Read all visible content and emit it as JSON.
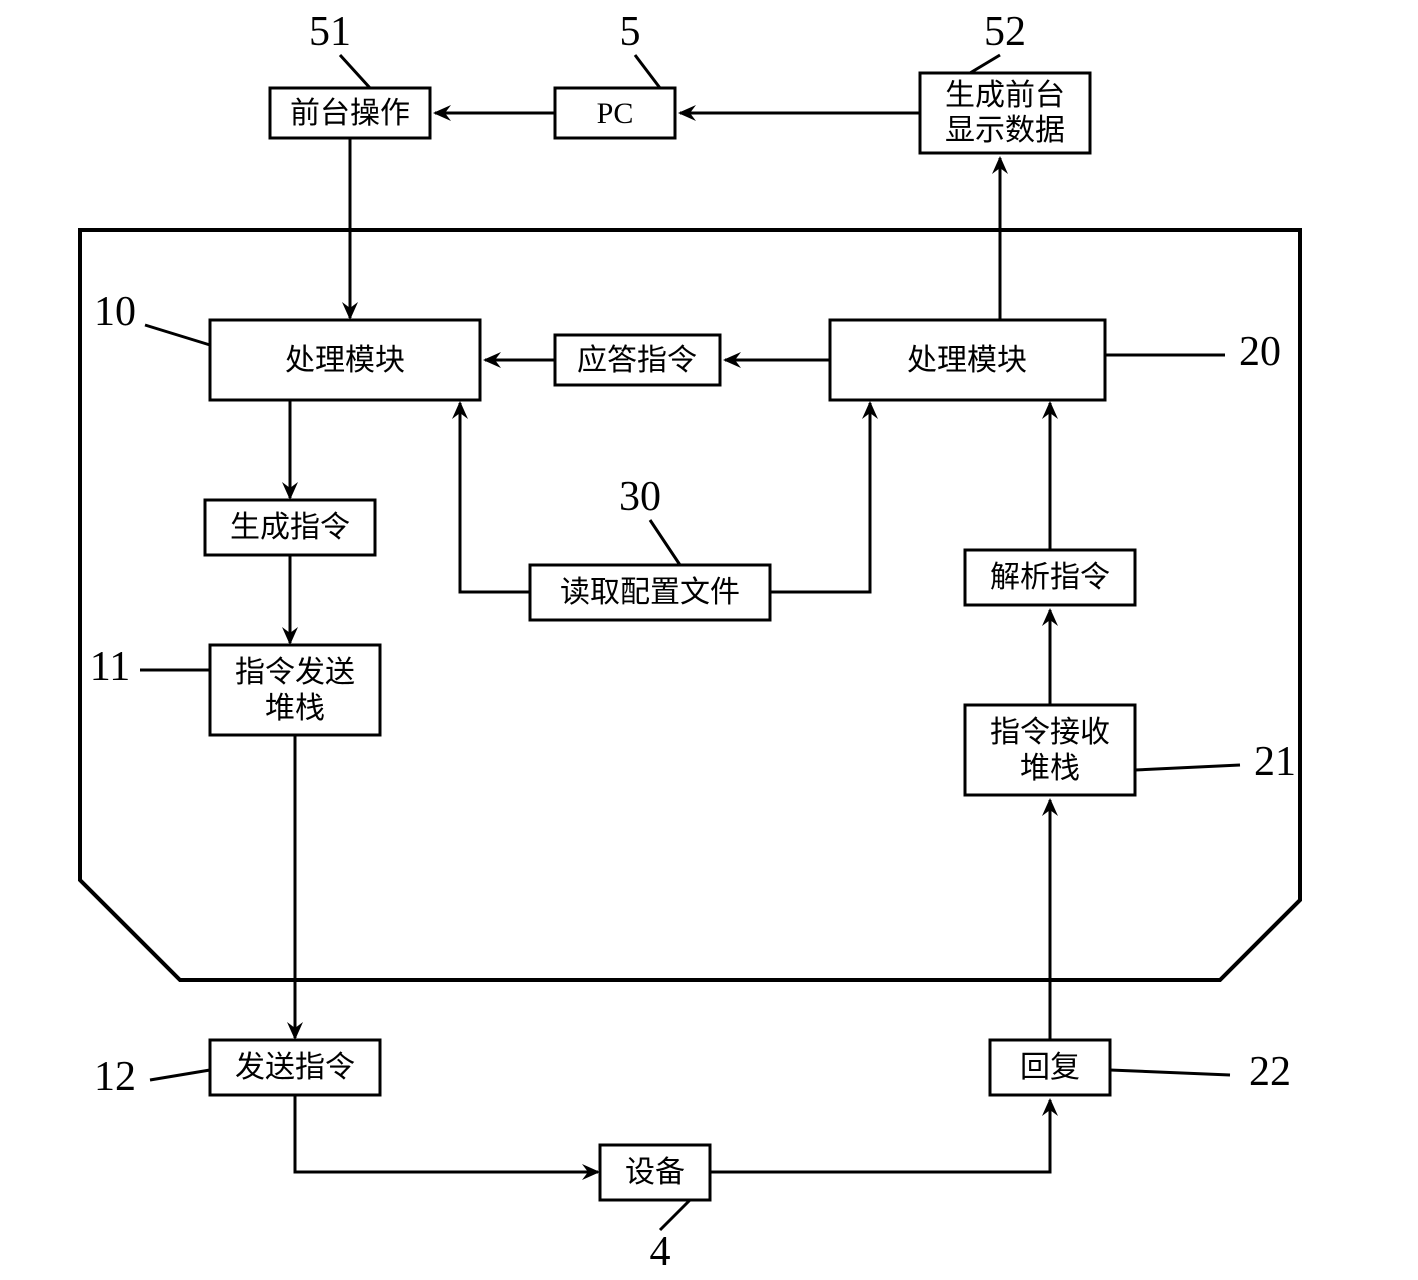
{
  "labels": {
    "frontend_op": "前台操作",
    "pc": "PC",
    "gen_display_l1": "生成前台",
    "gen_display_l2": "显示数据",
    "proc_left": "处理模块",
    "proc_right": "处理模块",
    "resp_cmd": "应答指令",
    "gen_cmd": "生成指令",
    "read_cfg": "读取配置文件",
    "parse_cmd": "解析指令",
    "send_stack_l1": "指令发送",
    "send_stack_l2": "堆栈",
    "recv_stack_l1": "指令接收",
    "recv_stack_l2": "堆栈",
    "send_cmd": "发送指令",
    "reply": "回复",
    "device": "设备"
  },
  "numbers": {
    "n51": "51",
    "n5": "5",
    "n52": "52",
    "n10": "10",
    "n20": "20",
    "n30": "30",
    "n11": "11",
    "n21": "21",
    "n12": "12",
    "n22": "22",
    "n4": "4"
  }
}
